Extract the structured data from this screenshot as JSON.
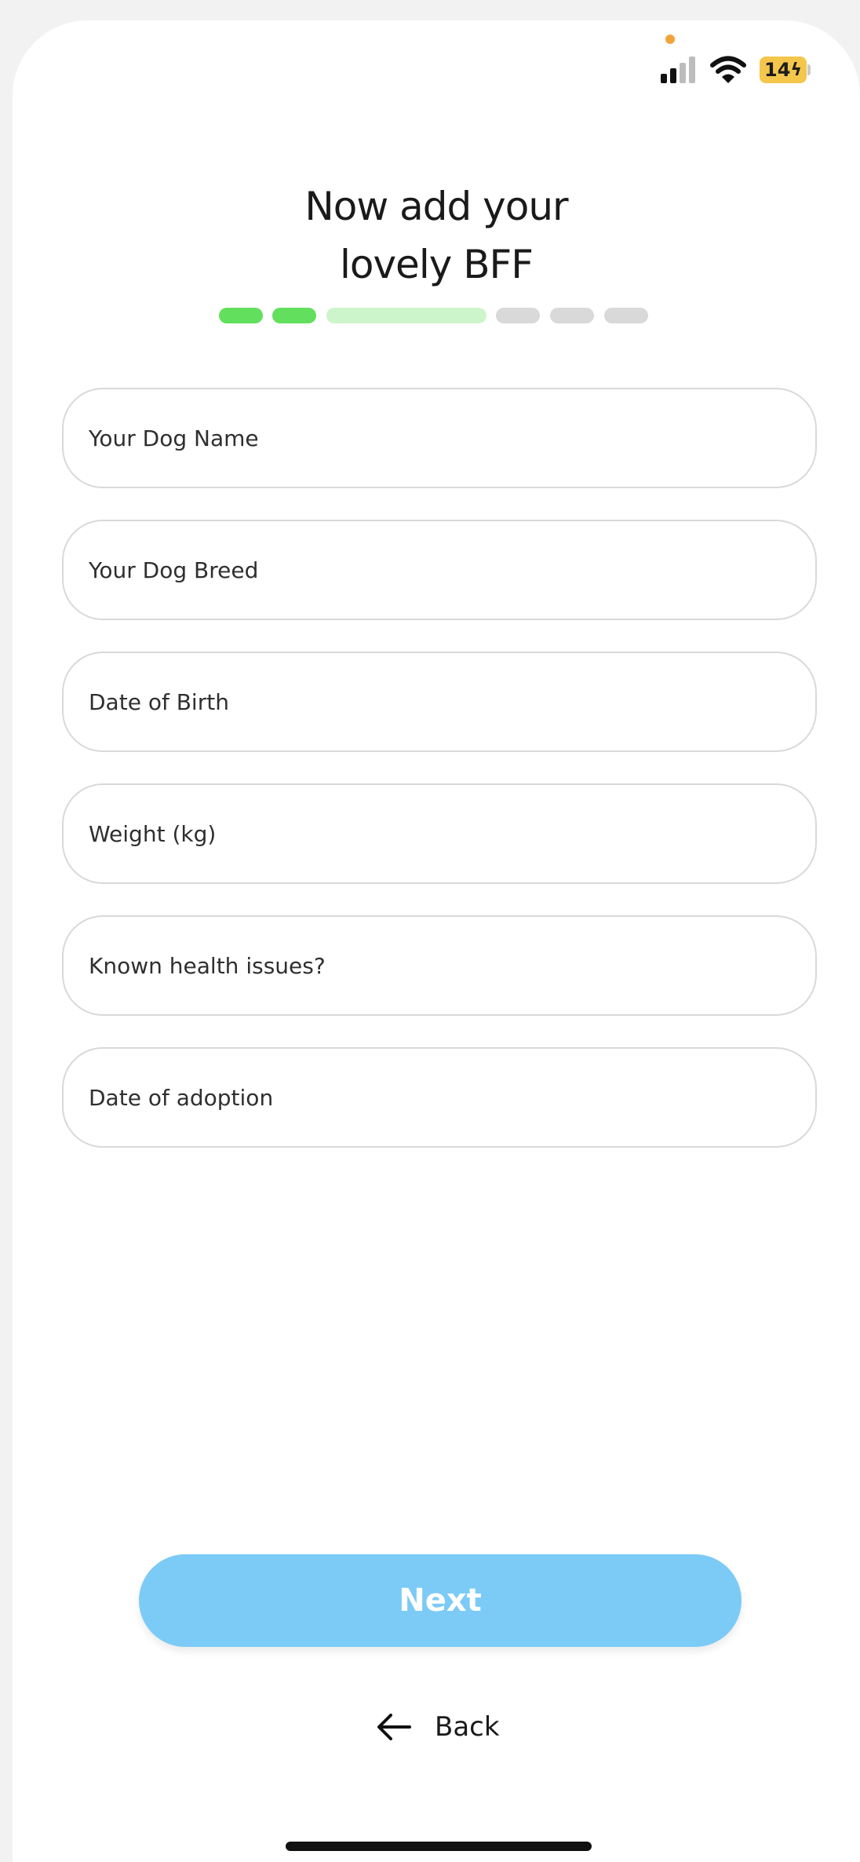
{
  "status_bar": {
    "battery_level": "14",
    "battery_color": "#f4c64c",
    "indicator_color": "#f2a33a",
    "icons": [
      "signal-icon",
      "wifi-icon",
      "battery-charging-icon"
    ]
  },
  "header": {
    "title_line1": "Now add your",
    "title_line2": "lovely BFF"
  },
  "progress": {
    "steps": [
      {
        "state": "completed",
        "color": "#62df5c"
      },
      {
        "state": "completed",
        "color": "#62df5c"
      },
      {
        "state": "current",
        "color": "#cdf5cb"
      },
      {
        "state": "upcoming",
        "color": "#d9d9d9"
      },
      {
        "state": "upcoming",
        "color": "#d9d9d9"
      },
      {
        "state": "upcoming",
        "color": "#d9d9d9"
      }
    ]
  },
  "form": {
    "fields": [
      {
        "name": "dog-name-field",
        "placeholder": "Your Dog Name",
        "value": ""
      },
      {
        "name": "dog-breed-field",
        "placeholder": "Your Dog Breed",
        "value": ""
      },
      {
        "name": "date-of-birth-field",
        "placeholder": "Date of Birth",
        "value": ""
      },
      {
        "name": "weight-field",
        "placeholder": "Weight (kg)",
        "value": ""
      },
      {
        "name": "health-issues-field",
        "placeholder": "Known health issues?",
        "value": ""
      },
      {
        "name": "date-of-adoption-field",
        "placeholder": "Date of adoption",
        "value": ""
      }
    ]
  },
  "actions": {
    "next_label": "Next",
    "next_color": "#7ccbf7",
    "back_label": "Back",
    "back_icon": "arrow-left-icon"
  }
}
